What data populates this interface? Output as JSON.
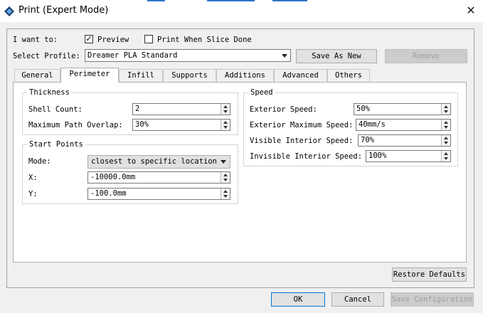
{
  "window": {
    "title": "Print (Expert Mode)",
    "accent": "#2f74c9"
  },
  "top": {
    "i_want_to_label": "I want to:",
    "preview_label": "Preview",
    "preview_checked": true,
    "print_when_done_label": "Print When Slice Done",
    "print_when_done_checked": false,
    "select_profile_label": "Select Profile:",
    "profile_value": "Dreamer PLA Standard",
    "save_as_new_label": "Save As New",
    "remove_label": "Remove"
  },
  "tabs": [
    {
      "label": "General",
      "active": false
    },
    {
      "label": "Perimeter",
      "active": true
    },
    {
      "label": "Infill",
      "active": false
    },
    {
      "label": "Supports",
      "active": false
    },
    {
      "label": "Additions",
      "active": false
    },
    {
      "label": "Advanced",
      "active": false
    },
    {
      "label": "Others",
      "active": false
    }
  ],
  "thickness": {
    "title": "Thickness",
    "shell_count_label": "Shell Count:",
    "shell_count_value": "2",
    "max_overlap_label": "Maximum Path Overlap:",
    "max_overlap_value": "30%"
  },
  "start_points": {
    "title": "Start Points",
    "mode_label": "Mode:",
    "mode_value": "closest to specific location",
    "x_label": "X:",
    "x_value": "-10000.0mm",
    "y_label": "Y:",
    "y_value": "-100.0mm"
  },
  "speed": {
    "title": "Speed",
    "exterior_label": "Exterior Speed:",
    "exterior_value": "50%",
    "exterior_max_label": "Exterior Maximum Speed:",
    "exterior_max_value": "40mm/s",
    "visible_interior_label": "Visible Interior Speed:",
    "visible_interior_value": "70%",
    "invisible_interior_label": "Invisible Interior Speed:",
    "invisible_interior_value": "100%"
  },
  "footer": {
    "restore_defaults_label": "Restore Defaults",
    "ok_label": "OK",
    "cancel_label": "Cancel",
    "save_configuration_label": "Save Configuration"
  }
}
